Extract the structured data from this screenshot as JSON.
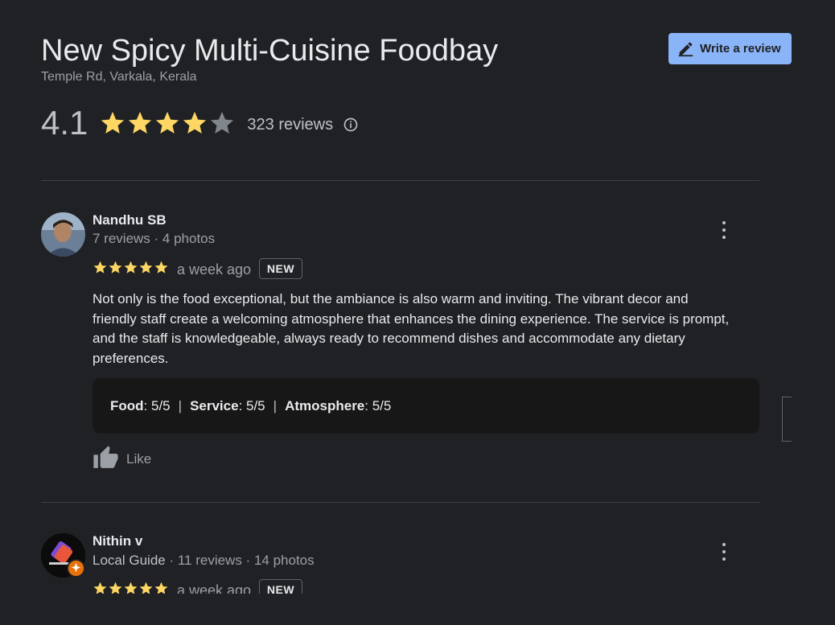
{
  "header": {
    "title": "New Spicy Multi-Cuisine Foodbay",
    "address": "Temple Rd, Varkala, Kerala",
    "write_review_label": "Write a review"
  },
  "summary": {
    "rating": "4.1",
    "rating_value": 4.1,
    "reviews_count": "323 reviews",
    "info_icon": "info-icon"
  },
  "colors": {
    "background": "#202124",
    "accent": "#8ab4f8",
    "star": "#fdd663"
  },
  "reviews": [
    {
      "name": "Nandhu SB",
      "meta": "7 reviews · 4 photos",
      "stars": 5,
      "time": "a week ago",
      "badge": "NEW",
      "text": "Not only is the food exceptional, but the ambiance is also warm and inviting. The vibrant decor and friendly staff create a welcoming atmosphere that enhances the dining experience. The service is prompt, and the staff is knowledgeable, always ready to recommend dishes and accommodate any dietary preferences.",
      "scores": [
        {
          "label": "Food",
          "value": ": 5/5"
        },
        {
          "label": "Service",
          "value": ": 5/5"
        },
        {
          "label": "Atmosphere",
          "value": ": 5/5"
        }
      ],
      "score_separator": "|",
      "like_label": "Like"
    },
    {
      "name": "Nithin v",
      "guide": "Local Guide",
      "meta": " · 11 reviews · 14 photos",
      "stars": 5,
      "time": "a week ago",
      "badge": "NEW"
    }
  ]
}
